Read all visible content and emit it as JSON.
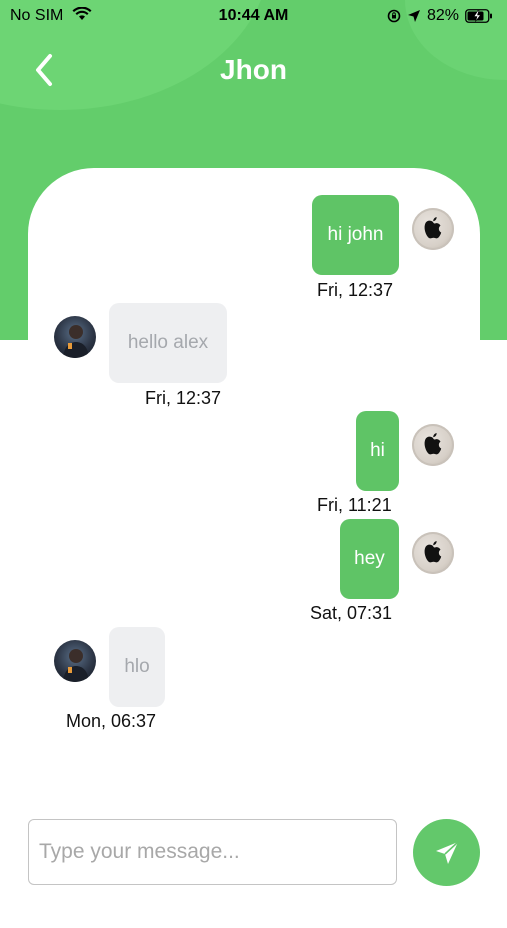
{
  "status_bar": {
    "carrier": "No SIM",
    "time": "10:44 AM",
    "battery": "82%"
  },
  "header": {
    "title": "Jhon"
  },
  "messages": [
    {
      "text": "hi john",
      "time": "Fri, 12:37",
      "side": "outgoing"
    },
    {
      "text": "hello alex",
      "time": "Fri, 12:37",
      "side": "incoming"
    },
    {
      "text": "hi",
      "time": "Fri, 11:21",
      "side": "outgoing"
    },
    {
      "text": "hey",
      "time": "Sat, 07:31",
      "side": "outgoing"
    },
    {
      "text": "hlo",
      "time": "Mon, 06:37",
      "side": "incoming"
    }
  ],
  "composer": {
    "placeholder": "Type your message..."
  },
  "colors": {
    "primary": "#63cd6b",
    "outgoing_bubble": "#5fc466",
    "incoming_bubble": "#eeeff1"
  }
}
